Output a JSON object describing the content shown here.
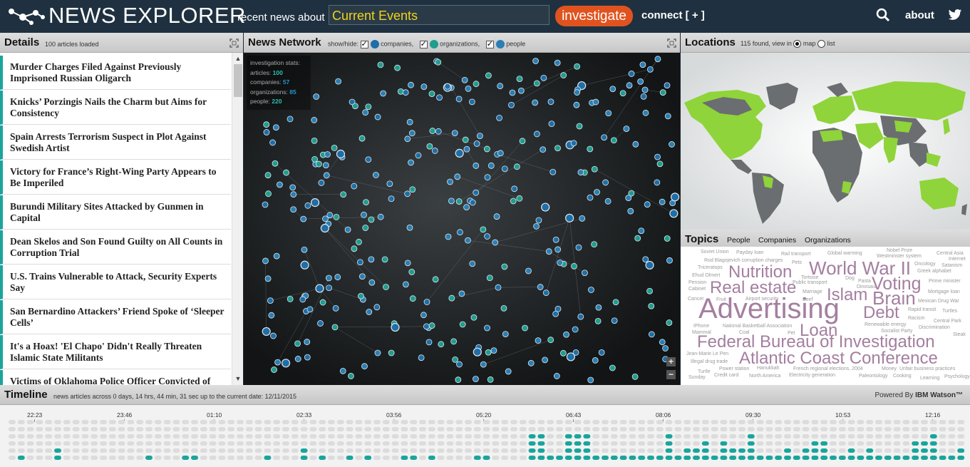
{
  "header": {
    "brand": "NEWS EXPLORER",
    "recent_label": "recent news about",
    "search_value": "Current Events",
    "investigate_label": "investigate",
    "connect_label": "connect [ + ]",
    "about_label": "about",
    "icons": [
      "logo-network-icon",
      "search-icon",
      "twitter-icon"
    ]
  },
  "details": {
    "title": "Details",
    "subtitle": "100 articles loaded",
    "articles": [
      "Murder Charges Filed Against Previously Imprisoned Russian Oligarch",
      "Knicks’ Porzingis Nails the Charm but Aims for Consistency",
      "Spain Arrests Terrorism Suspect in Plot Against Swedish Artist",
      "Victory for France’s Right-Wing Party Appears to Be Imperiled",
      "Burundi Military Sites Attacked by Gunmen in Capital",
      "Dean Skelos and Son Found Guilty on All Counts in Corruption Trial",
      "U.S. Trains Vulnerable to Attack, Security Experts Say",
      "San Bernardino Attackers’ Friend Spoke of ‘Sleeper Cells’",
      "It's a Hoax! 'El Chapo' Didn't Really Threaten Islamic State Militants",
      "Victims of Oklahoma Police Officer Convicted of"
    ],
    "accent_color": "#1aa59c"
  },
  "network": {
    "title": "News Network",
    "show_hide_label": "show/hide:",
    "filters": [
      "companies,",
      "organizations,",
      "people"
    ],
    "stats": {
      "heading": "investigation stats:",
      "articles_label": "articles:",
      "articles_value": "100",
      "companies_label": "companies:",
      "companies_value": "57",
      "organizations_label": "organizations:",
      "organizations_value": "85",
      "people_label": "people:",
      "people_value": "220"
    },
    "zoom_in": "+",
    "zoom_out": "−",
    "node_colors": {
      "people": "#2a7fb5",
      "organizations": "#1f9d8f",
      "companies": "#1e6ea8"
    }
  },
  "locations": {
    "title": "Locations",
    "subtitle": "115 found, view in",
    "opt_map": "map",
    "opt_list": "list",
    "land_color": "#6b6e70",
    "highlight_color": "#8fd43a"
  },
  "topics": {
    "title": "Topics",
    "tabs": [
      "People",
      "Companies",
      "Organizations"
    ],
    "words": [
      "Soviet Union",
      "Payday loan",
      "Rail transport",
      "Global warming",
      "Nobel Prize",
      "Central Asia",
      "Rod Blagojevich corruption charges",
      "Pets",
      "Westminster system",
      "Internet",
      "Triceratops",
      "Nutrition",
      "World War II",
      "Oncology",
      "Satanism",
      "Ehud Olmert",
      "Tortoise",
      "Dog",
      "Greek alphabet",
      "Pension",
      "Public transport",
      "Pasta",
      "Voting",
      "Prime minister",
      "Cabinet",
      "Real estate",
      "Dinosaur",
      "Marriage",
      "Islam",
      "Mortgage loan",
      "Cancer",
      "Fruit",
      "Airport security",
      "Beef",
      "Brain",
      "Mexican Drug War",
      "Advertising",
      "Debt",
      "Rapid transit",
      "Turtles",
      "Racism",
      "Central Park",
      "IPhone",
      "National Basketball Association",
      "Renewable energy",
      "Discrimination",
      "Mammal",
      "Coal",
      "Pet",
      "Loan",
      "Socialist Party",
      "Steak",
      "Federal Bureau of Investigation",
      "Jean-Marie Le Pen",
      "Illegal drug trade",
      "Atlantic Coast Conference",
      "Turtle",
      "Power station",
      "Hanukkah",
      "French regional elections, 2004",
      "Money",
      "Unfair business practices",
      "Sunday",
      "Credit card",
      "North America",
      "Electricity generation",
      "Paleontology",
      "Cooking",
      "Learning",
      "Psychology"
    ]
  },
  "timeline": {
    "title": "Timeline",
    "subtitle": "news articles across 0 days, 14 hrs, 44 min, 31 sec up to the current date: 12/11/2015",
    "powered_by": "Powered By",
    "powered_brand": "IBM Watson™",
    "ticks": [
      "22:23",
      "23:46",
      "01:10",
      "02:33",
      "03:56",
      "05:20",
      "06:43",
      "08:06",
      "09:30",
      "10:53",
      "12:16"
    ],
    "active_color": "#1aa59c"
  }
}
